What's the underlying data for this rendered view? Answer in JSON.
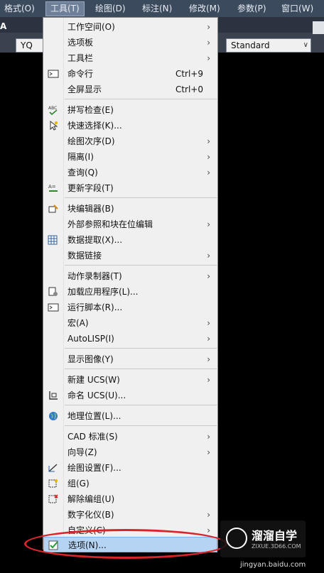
{
  "menubar": {
    "items": [
      "格式(O)",
      "工具(T)",
      "绘图(D)",
      "标注(N)",
      "修改(M)",
      "参数(P)",
      "窗口(W)"
    ]
  },
  "toolbar": {
    "text_a": "A",
    "combo_left_value": "YQ",
    "combo_right_value": "Standard"
  },
  "menu": {
    "items": [
      {
        "label": "工作空间(O)"
      },
      {
        "label": "选项板"
      },
      {
        "label": "工具栏"
      },
      {
        "label": "命令行",
        "shortcut": "Ctrl+9"
      },
      {
        "label": "全屏显示",
        "shortcut": "Ctrl+0"
      },
      {
        "label": "拼写检查(E)"
      },
      {
        "label": "快速选择(K)..."
      },
      {
        "label": "绘图次序(D)"
      },
      {
        "label": "隔离(I)"
      },
      {
        "label": "查询(Q)"
      },
      {
        "label": "更新字段(T)"
      },
      {
        "label": "块编辑器(B)"
      },
      {
        "label": "外部参照和块在位编辑"
      },
      {
        "label": "数据提取(X)..."
      },
      {
        "label": "数据链接"
      },
      {
        "label": "动作录制器(T)"
      },
      {
        "label": "加载应用程序(L)..."
      },
      {
        "label": "运行脚本(R)..."
      },
      {
        "label": "宏(A)"
      },
      {
        "label": "AutoLISP(I)"
      },
      {
        "label": "显示图像(Y)"
      },
      {
        "label": "新建 UCS(W)"
      },
      {
        "label": "命名 UCS(U)..."
      },
      {
        "label": "地理位置(L)..."
      },
      {
        "label": "CAD 标准(S)"
      },
      {
        "label": "向导(Z)"
      },
      {
        "label": "绘图设置(F)..."
      },
      {
        "label": "组(G)"
      },
      {
        "label": "解除编组(U)"
      },
      {
        "label": "数字化仪(B)"
      },
      {
        "label": "自定义(C)"
      },
      {
        "label": "选项(N)..."
      }
    ],
    "submenu_glyph": "›"
  },
  "watermark": {
    "title": "溜溜自学",
    "subtitle": "ZIXUE.3D66.COM",
    "credit": "jingyan.baidu.com"
  },
  "colors": {
    "menubar_bg": "#3c4a5e",
    "menu_bg": "#f0f0f0",
    "highlight": "#b5d3f3",
    "annotation": "#d9252a"
  }
}
